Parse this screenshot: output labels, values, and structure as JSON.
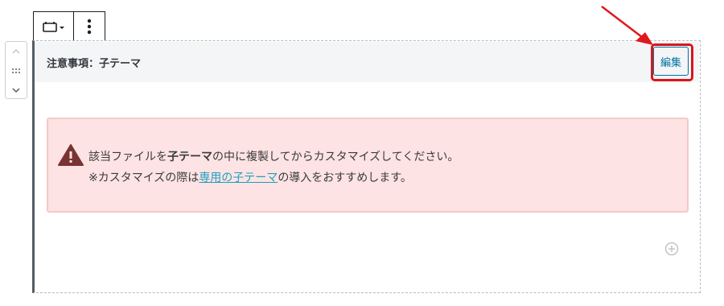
{
  "toolbar": {
    "block_type_icon": "block-type-icon",
    "more_icon": "vertical-ellipsis-icon"
  },
  "mover": {
    "up_icon": "chevron-up-icon",
    "drag_icon": "drag-handle-icon",
    "down_icon": "chevron-down-icon"
  },
  "block": {
    "title": "注意事項：子テーマ",
    "edit_label": "編集"
  },
  "alert": {
    "icon": "warning-icon",
    "line1_pre": "該当ファイルを",
    "line1_strong": "子テーマ",
    "line1_post": "の中に複製してからカスタマイズしてください。",
    "line2_pre": "※カスタマイズの際は",
    "line2_link": "専用の子テーマ",
    "line2_post": "の導入をおすすめします。"
  },
  "add_block": {
    "icon": "plus-circle-icon"
  },
  "colors": {
    "highlight": "#d8161b",
    "accent": "#0071a1",
    "alert_bg": "#fde3e3",
    "alert_border": "#f6c8c8",
    "warning_icon": "#7a3333",
    "link": "#1e9fbf"
  }
}
